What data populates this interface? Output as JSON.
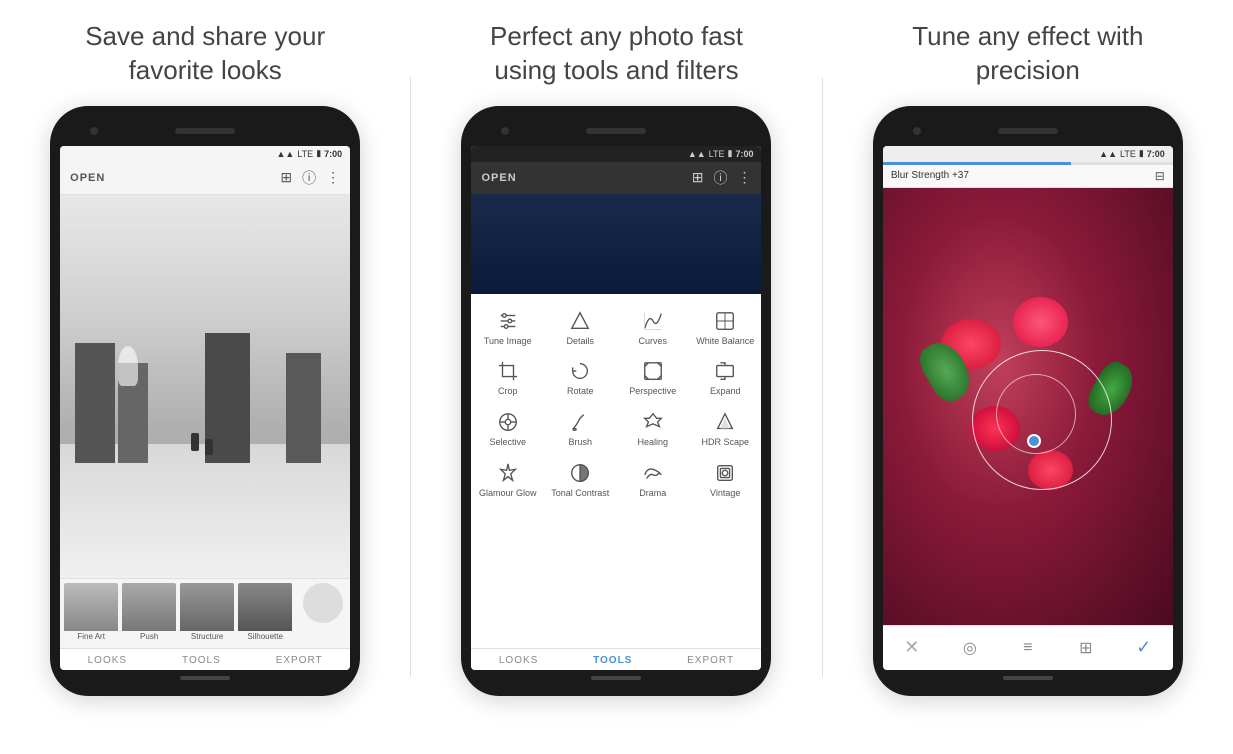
{
  "panels": [
    {
      "id": "panel1",
      "title": "Save and share your\nfavorite looks",
      "app_bar": {
        "open_label": "OPEN",
        "icons": [
          "layers",
          "info",
          "more-vert"
        ]
      },
      "status_bar": {
        "signal": "▲▲",
        "lte": "LTE",
        "battery": "🔋",
        "time": "7:00"
      },
      "looks_strip": [
        {
          "label": "Fine Art",
          "color": "#888"
        },
        {
          "label": "Push",
          "color": "#777"
        },
        {
          "label": "Structure",
          "color": "#666"
        },
        {
          "label": "Silhouette",
          "color": "#555"
        },
        {
          "label": "",
          "color": "#ccc"
        }
      ],
      "nav": [
        {
          "label": "LOOKS",
          "active": false
        },
        {
          "label": "TOOLS",
          "active": false
        },
        {
          "label": "EXPORT",
          "active": false
        }
      ]
    },
    {
      "id": "panel2",
      "title": "Perfect any photo fast\nusing tools and filters",
      "app_bar": {
        "open_label": "OPEN"
      },
      "tools": [
        {
          "label": "Tune Image",
          "icon": "tune"
        },
        {
          "label": "Details",
          "icon": "details"
        },
        {
          "label": "Curves",
          "icon": "curves"
        },
        {
          "label": "White Balance",
          "icon": "wb"
        },
        {
          "label": "Crop",
          "icon": "crop"
        },
        {
          "label": "Rotate",
          "icon": "rotate"
        },
        {
          "label": "Perspective",
          "icon": "perspective"
        },
        {
          "label": "Expand",
          "icon": "expand"
        },
        {
          "label": "Selective",
          "icon": "selective"
        },
        {
          "label": "Brush",
          "icon": "brush"
        },
        {
          "label": "Healing",
          "icon": "healing"
        },
        {
          "label": "HDR Scape",
          "icon": "hdr"
        },
        {
          "label": "Glamour Glow",
          "icon": "glamour"
        },
        {
          "label": "Tonal Contrast",
          "icon": "tonal"
        },
        {
          "label": "Drama",
          "icon": "drama"
        },
        {
          "label": "Vintage",
          "icon": "vintage"
        }
      ],
      "nav": [
        {
          "label": "LOOKS",
          "active": false
        },
        {
          "label": "TOOLS",
          "active": true
        },
        {
          "label": "EXPORT",
          "active": false
        }
      ]
    },
    {
      "id": "panel3",
      "title": "Tune any effect with\nprecision",
      "blur_label": "Blur Strength +37",
      "toolbar_icons": [
        "close",
        "target",
        "sliders",
        "layers",
        "checkmark"
      ]
    }
  ]
}
